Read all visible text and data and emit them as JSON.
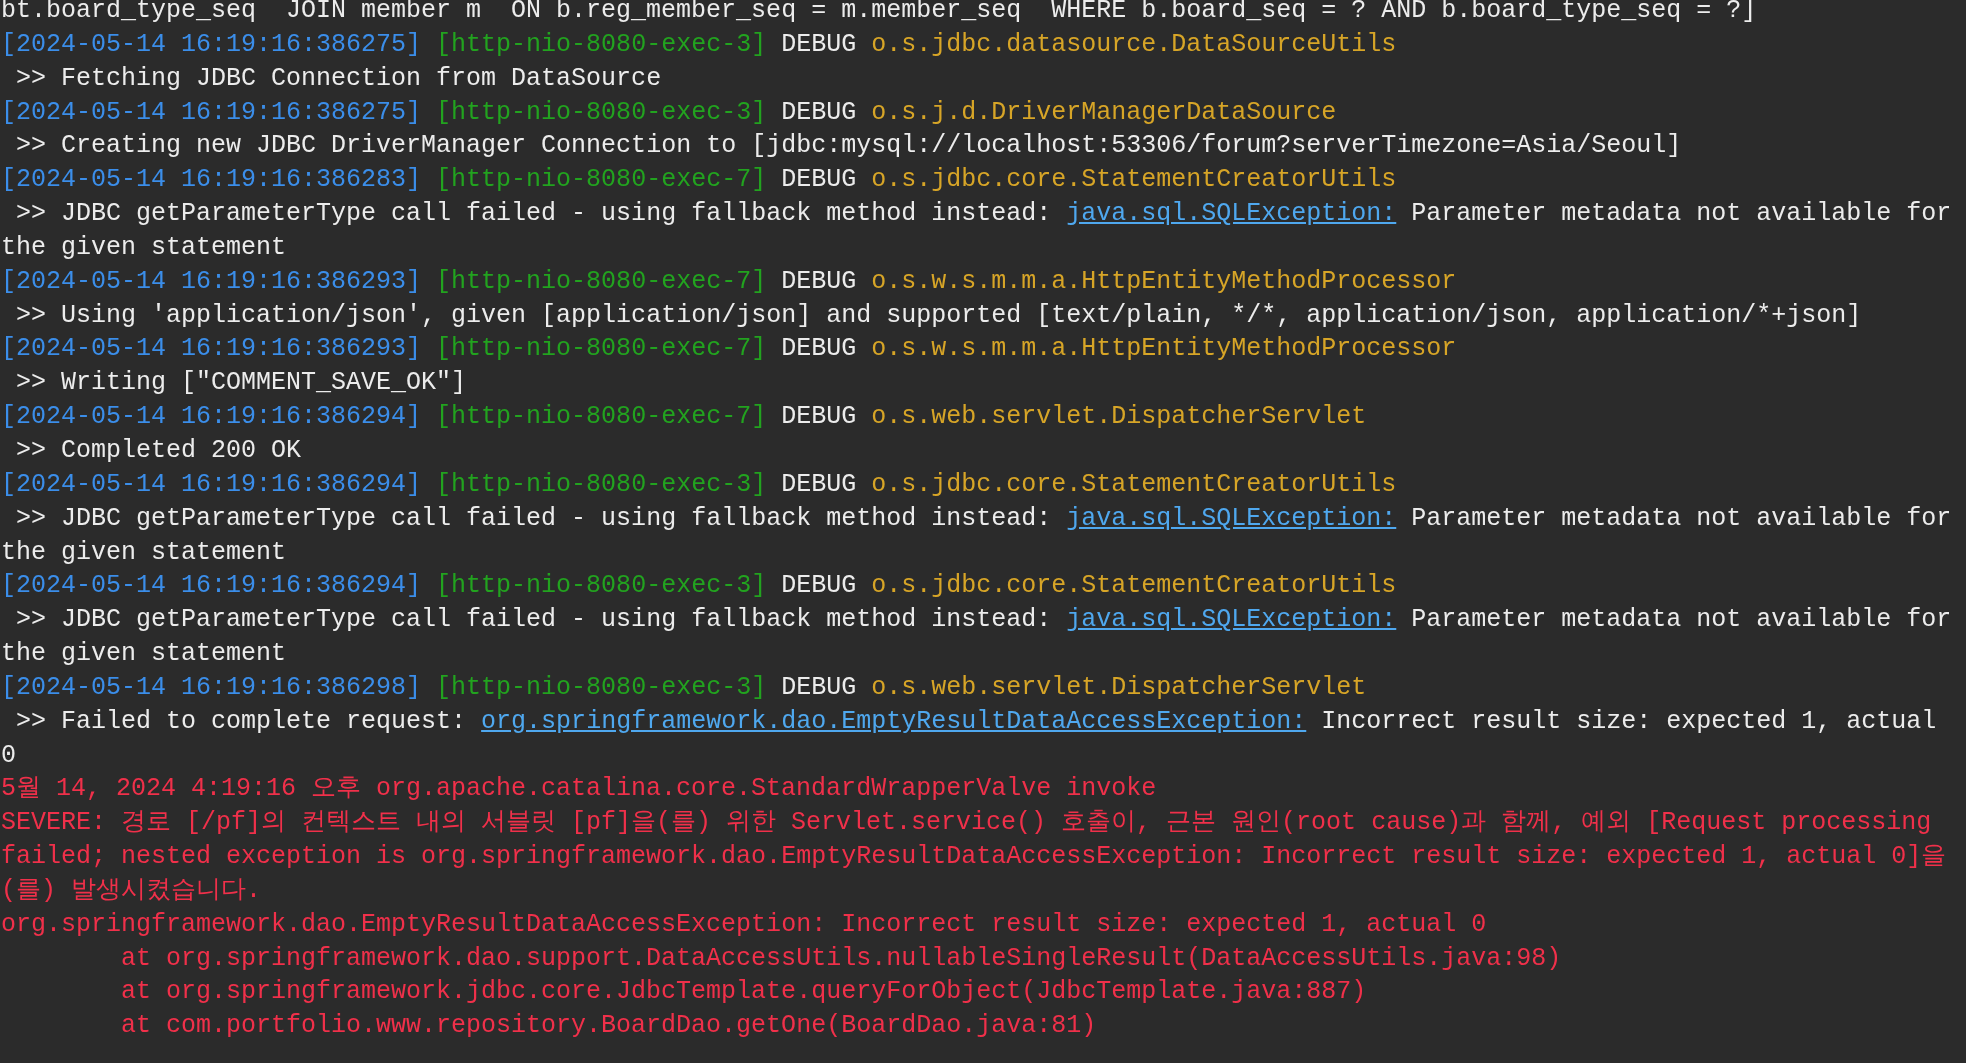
{
  "console": {
    "lines": [
      {
        "kind": "plain",
        "text": "bt.board_type_seq  JOIN member m  ON b.reg_member_seq = m.member_seq  WHERE b.board_seq = ? AND b.board_type_seq = ?]"
      },
      {
        "kind": "debug",
        "timestamp": "[2024-05-14 16:19:16:386275]",
        "thread": "[http-nio-8080-exec-3]",
        "level": "DEBUG",
        "logger": "o.s.jdbc.datasource.DataSourceUtils"
      },
      {
        "kind": "message",
        "prefix": ">>",
        "parts": [
          {
            "kind": "text",
            "text": "Fetching JDBC Connection from DataSource"
          }
        ]
      },
      {
        "kind": "debug",
        "timestamp": "[2024-05-14 16:19:16:386275]",
        "thread": "[http-nio-8080-exec-3]",
        "level": "DEBUG",
        "logger": "o.s.j.d.DriverManagerDataSource"
      },
      {
        "kind": "message",
        "prefix": ">>",
        "parts": [
          {
            "kind": "text",
            "text": "Creating new JDBC DriverManager Connection to [jdbc:mysql://localhost:53306/forum?serverTimezone=Asia/Seoul]"
          }
        ]
      },
      {
        "kind": "debug",
        "timestamp": "[2024-05-14 16:19:16:386283]",
        "thread": "[http-nio-8080-exec-7]",
        "level": "DEBUG",
        "logger": "o.s.jdbc.core.StatementCreatorUtils"
      },
      {
        "kind": "message",
        "prefix": ">>",
        "parts": [
          {
            "kind": "text",
            "text": "JDBC getParameterType call failed - using fallback method instead: "
          },
          {
            "kind": "link",
            "text": "java.sql.SQLException:"
          },
          {
            "kind": "text",
            "text": " Parameter metadata not available for the given statement"
          }
        ]
      },
      {
        "kind": "debug",
        "timestamp": "[2024-05-14 16:19:16:386293]",
        "thread": "[http-nio-8080-exec-7]",
        "level": "DEBUG",
        "logger": "o.s.w.s.m.m.a.HttpEntityMethodProcessor"
      },
      {
        "kind": "message",
        "prefix": ">>",
        "parts": [
          {
            "kind": "text",
            "text": "Using 'application/json', given [application/json] and supported [text/plain, */*, application/json, application/*+json]"
          }
        ]
      },
      {
        "kind": "debug",
        "timestamp": "[2024-05-14 16:19:16:386293]",
        "thread": "[http-nio-8080-exec-7]",
        "level": "DEBUG",
        "logger": "o.s.w.s.m.m.a.HttpEntityMethodProcessor"
      },
      {
        "kind": "message",
        "prefix": ">>",
        "parts": [
          {
            "kind": "text",
            "text": "Writing [\"COMMENT_SAVE_OK\"]"
          }
        ]
      },
      {
        "kind": "debug",
        "timestamp": "[2024-05-14 16:19:16:386294]",
        "thread": "[http-nio-8080-exec-7]",
        "level": "DEBUG",
        "logger": "o.s.web.servlet.DispatcherServlet"
      },
      {
        "kind": "message",
        "prefix": ">>",
        "parts": [
          {
            "kind": "text",
            "text": "Completed 200 OK"
          }
        ]
      },
      {
        "kind": "debug",
        "timestamp": "[2024-05-14 16:19:16:386294]",
        "thread": "[http-nio-8080-exec-3]",
        "level": "DEBUG",
        "logger": "o.s.jdbc.core.StatementCreatorUtils"
      },
      {
        "kind": "message",
        "prefix": ">>",
        "parts": [
          {
            "kind": "text",
            "text": "JDBC getParameterType call failed - using fallback method instead: "
          },
          {
            "kind": "link",
            "text": "java.sql.SQLException:"
          },
          {
            "kind": "text",
            "text": " Parameter metadata not available for the given statement"
          }
        ]
      },
      {
        "kind": "debug",
        "timestamp": "[2024-05-14 16:19:16:386294]",
        "thread": "[http-nio-8080-exec-3]",
        "level": "DEBUG",
        "logger": "o.s.jdbc.core.StatementCreatorUtils"
      },
      {
        "kind": "message",
        "prefix": ">>",
        "parts": [
          {
            "kind": "text",
            "text": "JDBC getParameterType call failed - using fallback method instead: "
          },
          {
            "kind": "link",
            "text": "java.sql.SQLException:"
          },
          {
            "kind": "text",
            "text": " Parameter metadata not available for the given statement"
          }
        ]
      },
      {
        "kind": "debug",
        "timestamp": "[2024-05-14 16:19:16:386298]",
        "thread": "[http-nio-8080-exec-3]",
        "level": "DEBUG",
        "logger": "o.s.web.servlet.DispatcherServlet"
      },
      {
        "kind": "message",
        "prefix": ">>",
        "parts": [
          {
            "kind": "text",
            "text": "Failed to complete request: "
          },
          {
            "kind": "link",
            "text": "org.springframework.dao.EmptyResultDataAccessException:"
          },
          {
            "kind": "text",
            "text": " Incorrect result size: expected 1, actual 0"
          }
        ]
      },
      {
        "kind": "error",
        "text": "5월 14, 2024 4:19:16 오후 org.apache.catalina.core.StandardWrapperValve invoke"
      },
      {
        "kind": "error",
        "text": "SEVERE: 경로 [/pf]의 컨텍스트 내의 서블릿 [pf]을(를) 위한 Servlet.service() 호출이, 근본 원인(root cause)과 함께, 예외 [Request processing failed; nested exception is org.springframework.dao.EmptyResultDataAccessException: Incorrect result size: expected 1, actual 0]을(를) 발생시켰습니다."
      },
      {
        "kind": "error",
        "text": "org.springframework.dao.EmptyResultDataAccessException: Incorrect result size: expected 1, actual 0"
      },
      {
        "kind": "trace",
        "text": "at org.springframework.dao.support.DataAccessUtils.nullableSingleResult(DataAccessUtils.java:98)"
      },
      {
        "kind": "trace",
        "text": "at org.springframework.jdbc.core.JdbcTemplate.queryForObject(JdbcTemplate.java:887)"
      },
      {
        "kind": "trace",
        "text": "at com.portfolio.www.repository.BoardDao.getOne(BoardDao.java:81)"
      }
    ]
  }
}
